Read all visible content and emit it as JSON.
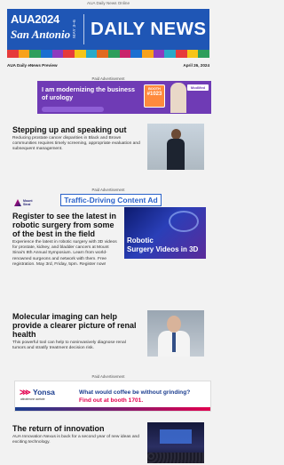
{
  "topline": "AUA Daily News Online",
  "masthead": {
    "org": "AUA2024",
    "city": "San Antonio",
    "dates": "MAY 3–6",
    "title": "DAILY NEWS"
  },
  "meta": {
    "preview": "AUA Daily eNews Preview",
    "date": "April 26, 2024"
  },
  "ad_label": "Paid Advertisement",
  "ad1": {
    "headline": "I am modernizing the business of urology",
    "booth_label": "BOOTH",
    "booth_number": "#1023",
    "logo": "ModMed"
  },
  "articles": [
    {
      "title": "Stepping up and speaking out",
      "body": "Reducing prostate cancer disparities in Black and Brown communities requires timely screening, appropriate evaluation and subsequent management."
    },
    {
      "title": "Register to see the latest in robotic surgery from some of the best in the field",
      "body": "Experience the latest in robotic surgery with 3D videos for prostate, kidney, and bladder cancers at Mount Sinai's 8th Annual Symposium. Learn from world-renowned surgeons and network with them. Free registration. May 3rd, Friday, 5pm. Register now!"
    },
    {
      "title": "Molecular imaging can help provide a clearer picture of renal health",
      "body": "This powerful tool can help to noninvasively diagnose renal tumors and stratify treatment decision risk."
    },
    {
      "title": "The return of innovation",
      "body": "AUA Innovation Nexus is back for a second year of new ideas and exciting technology."
    }
  ],
  "sponsored": {
    "logo_text_top": "Mount",
    "logo_text_bottom": "Sinai",
    "badge": "Traffic-Driving Content Ad",
    "photo_caption_1": "Robotic",
    "photo_caption_2": "Surgery Videos in 3D"
  },
  "ad2": {
    "logo": "Yonsa",
    "logo_sub": "abiraterone acetate",
    "question": "What would coffee be without grinding?",
    "cta": "Find out at booth 1701."
  },
  "colors": {
    "masthead_blue": "#1f56b5",
    "ad_purple": "#6f3bb5",
    "badge_blue": "#2a62c9"
  }
}
